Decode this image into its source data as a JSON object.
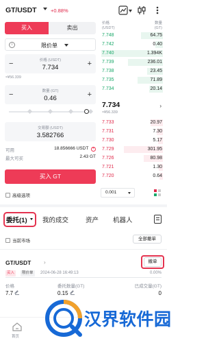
{
  "header": {
    "pair": "GT/USDT",
    "change": "+0.88%",
    "icons": [
      "chart-icon",
      "more-icon",
      "candle-icon"
    ]
  },
  "trade_form": {
    "tabs": [
      {
        "label": "买入",
        "active": true
      },
      {
        "label": "卖出",
        "active": false
      }
    ],
    "order_type": "限价单",
    "price_label": "价格 (USDT)",
    "price_value": "7.734",
    "price_fiat": "≈¥56.339",
    "qty_label": "数量 (GT)",
    "qty_value": "0.46",
    "slider_fraction": 0.93,
    "amount_label": "交易额 (USDT)",
    "amount_value": "3.582766",
    "available_label": "可用",
    "available_value": "18.856666 USDT",
    "max_buy_label": "最大可买",
    "max_buy_value": "2.43 GT",
    "buy_button": "买入 GT",
    "advanced_option": "高级选项"
  },
  "order_book": {
    "price_header": "价格",
    "price_unit": "(USDT)",
    "qty_header": "数量",
    "qty_unit": "(GT)",
    "bids_top": [
      {
        "price": "7.748",
        "qty": "64.75",
        "depth": 0.35
      },
      {
        "price": "7.742",
        "qty": "0.40",
        "depth": 0.12
      },
      {
        "price": "7.740",
        "qty": "1.394K",
        "depth": 0.98
      },
      {
        "price": "7.739",
        "qty": "236.01",
        "depth": 0.55
      },
      {
        "price": "7.738",
        "qty": "23.45",
        "depth": 0.25
      },
      {
        "price": "7.735",
        "qty": "71.89",
        "depth": 0.4
      },
      {
        "price": "7.734",
        "qty": "20.14",
        "depth": 0.22
      }
    ],
    "mid_price": "7.734",
    "mid_fiat": "≈¥56.339",
    "asks_bottom": [
      {
        "price": "7.733",
        "qty": "20.97",
        "depth": 0.2
      },
      {
        "price": "7.731",
        "qty": "7.30",
        "depth": 0.1
      },
      {
        "price": "7.730",
        "qty": "5.17",
        "depth": 0.08
      },
      {
        "price": "7.729",
        "qty": "301.95",
        "depth": 0.62
      },
      {
        "price": "7.726",
        "qty": "80.98",
        "depth": 0.3
      },
      {
        "price": "7.721",
        "qty": "1.30",
        "depth": 0.06
      },
      {
        "price": "7.720",
        "qty": "0.64",
        "depth": 0.05
      }
    ],
    "precision": "0.001",
    "colors": {
      "green": "#1aa86a",
      "red": "#e0294a",
      "green_bg": "#e8f6ef",
      "red_bg": "#fdecef"
    }
  },
  "bottom_tabs": {
    "tabs": [
      "委托(1)",
      "我的成交",
      "资产",
      "机器人"
    ],
    "current_market": "当前市场",
    "cancel_all": "全部撤单"
  },
  "order": {
    "pair": "GT/USDT",
    "arrow": "›",
    "cancel": "撤单",
    "side_tag": "买入",
    "type_tag": "限价单",
    "time": "2024-06-28 16:49:13",
    "filled_pct": "0.00%",
    "price_label": "价格",
    "price_value": "7.7",
    "qty_label": "委托数量(GT)",
    "qty_value": "0.15",
    "filled_label": "已成交量(GT)",
    "filled_value": "0"
  },
  "nav": {
    "home": "首页"
  },
  "watermark": {
    "text": "汉界软件园"
  }
}
